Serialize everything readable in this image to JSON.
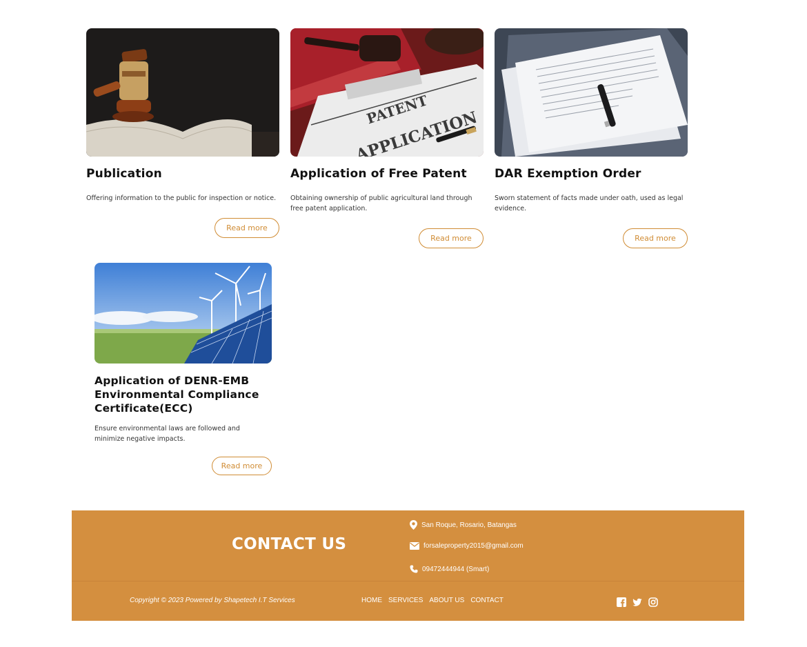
{
  "cards": [
    {
      "title": "Publication",
      "description": "Offering information to the public for inspection or notice.",
      "button": "Read more",
      "image_icon": "gavel-on-book-image"
    },
    {
      "title": "Application of Free Patent",
      "description": "Obtaining ownership of public agricultural land through free patent application.",
      "button": "Read more",
      "image_icon": "patent-application-image",
      "image_text_1": "PATENT",
      "image_text_2": "APPLICATION"
    },
    {
      "title": "DAR Exemption Order",
      "description": "Sworn statement of facts made under oath, used as legal evidence.",
      "button": "Read more",
      "image_icon": "documents-with-pen-image"
    },
    {
      "title": "Application of DENR-EMB Environmental Compliance Certificate(ECC)",
      "description": "Ensure environmental laws are followed and minimize negative impacts.",
      "button": "Read more",
      "image_icon": "wind-solar-farm-image"
    }
  ],
  "footer": {
    "contact_title": "CONTACT US",
    "address": "San Roque, Rosario, Batangas",
    "email": "forsaleproperty2015@gmail.com",
    "phone": "09472444944 (Smart)",
    "copyright": "Copyright © 2023 Powered by Shapetech I.T Services",
    "nav": [
      "HOME",
      "SERVICES",
      "ABOUT US",
      "CONTACT"
    ],
    "social_icons": [
      "facebook-icon",
      "twitter-icon",
      "instagram-icon"
    ]
  },
  "colors": {
    "accent": "#d08c34",
    "footer_bg": "#d48f3f",
    "text": "#111111"
  }
}
